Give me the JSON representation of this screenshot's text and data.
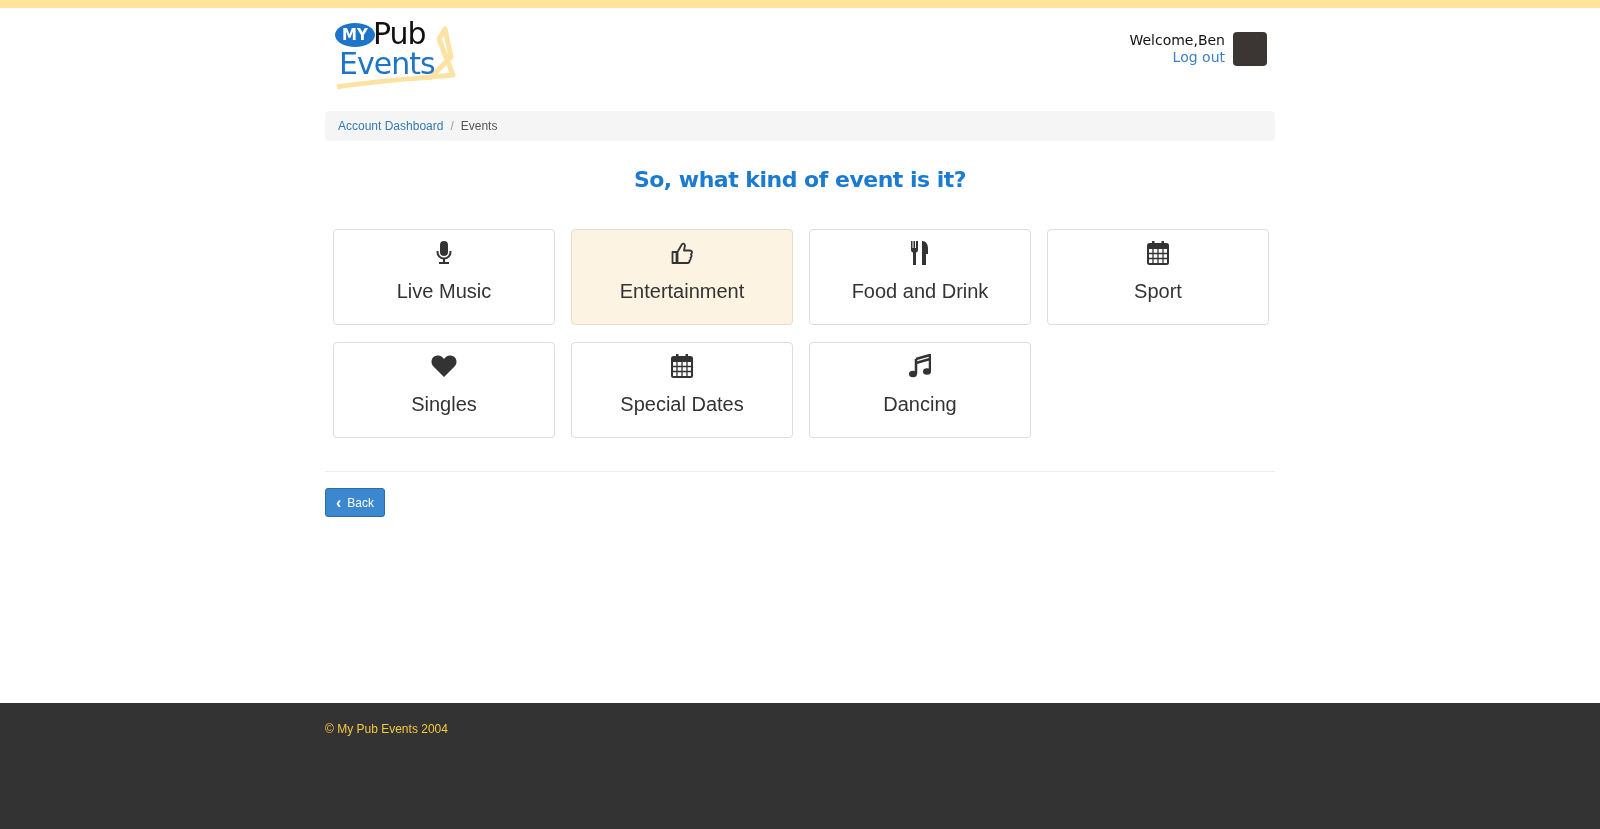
{
  "header": {
    "logo": {
      "badge": "MY",
      "word": "Pub",
      "subword": "Events"
    },
    "welcome": "Welcome,Ben",
    "logout": "Log out"
  },
  "breadcrumb": [
    {
      "label": "Account Dashboard",
      "kind": "link"
    },
    {
      "label": "Events",
      "kind": "current"
    }
  ],
  "breadcrumb_separator": "/",
  "heading": "So, what kind of event is it?",
  "categories": [
    {
      "label": "Live Music",
      "kind": "microphone",
      "selected": false
    },
    {
      "label": "Entertainment",
      "kind": "thumbs-up",
      "selected": true
    },
    {
      "label": "Food and Drink",
      "kind": "cutlery",
      "selected": false
    },
    {
      "label": "Sport",
      "kind": "calendar",
      "selected": false
    },
    {
      "label": "Singles",
      "kind": "heart",
      "selected": false
    },
    {
      "label": "Special Dates",
      "kind": "calendar",
      "selected": false
    },
    {
      "label": "Dancing",
      "kind": "music",
      "selected": false
    }
  ],
  "back_button": {
    "icon": "‹",
    "label": "Back"
  },
  "footer": {
    "copyright": "© My Pub Events 2004"
  }
}
